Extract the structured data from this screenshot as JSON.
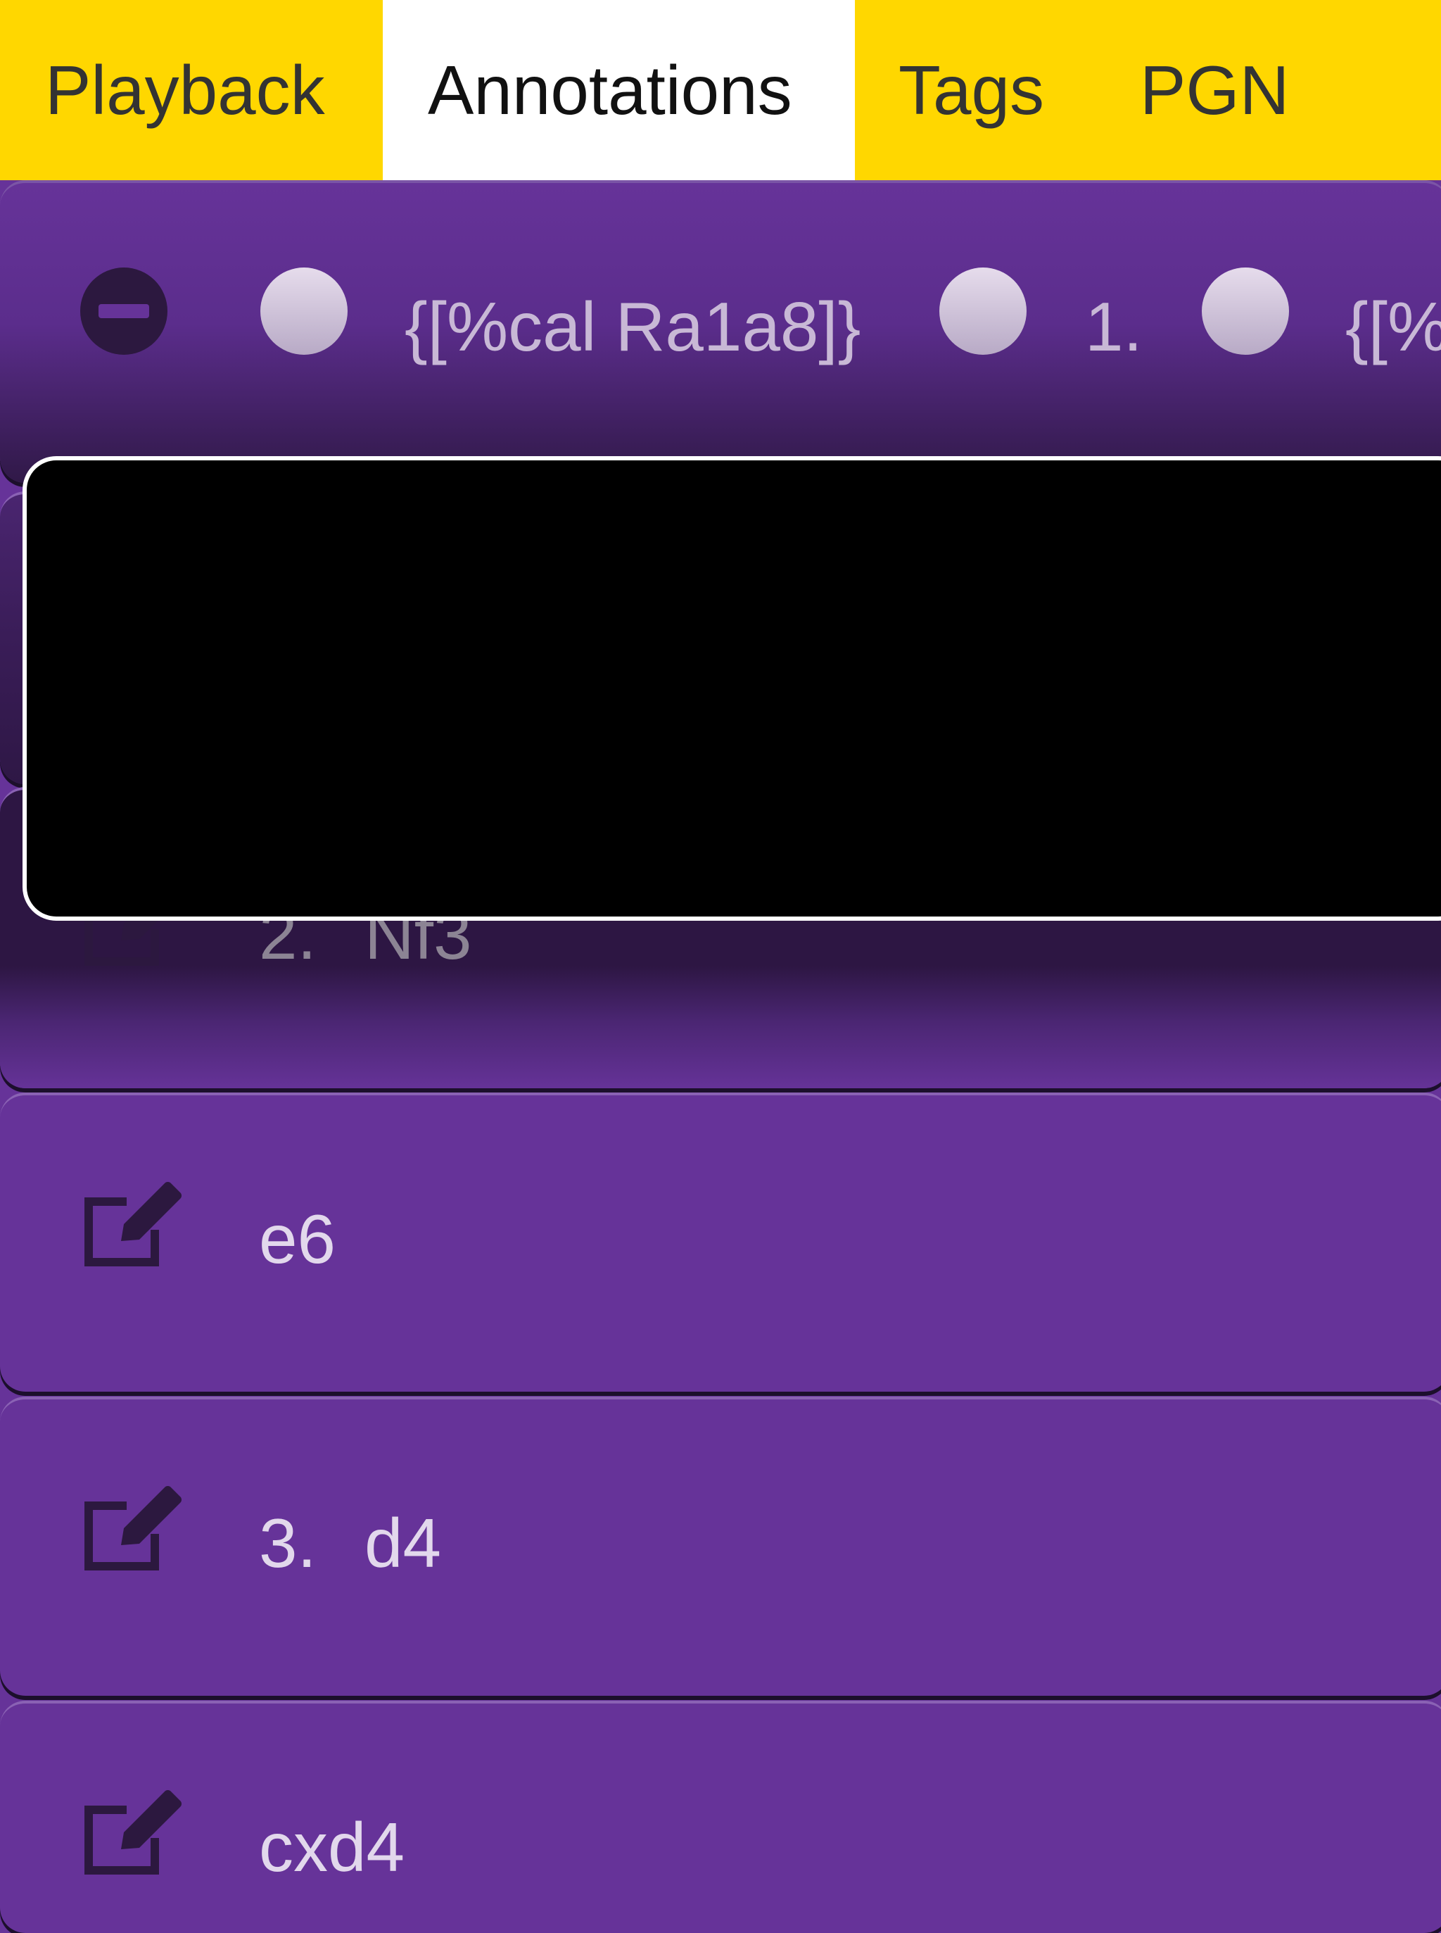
{
  "tabs": {
    "playback": "Playback",
    "annotations": "Annotations",
    "tags": "Tags",
    "pgn": "PGN"
  },
  "rows": {
    "first": {
      "comment1": "{[%cal Ra1a8]}",
      "move_number": "1.",
      "comment2_partial": "{[%"
    },
    "row3": {
      "number": "2.",
      "move": "Nf3"
    },
    "row4": {
      "move": "e6"
    },
    "row5": {
      "number": "3.",
      "move": "d4"
    },
    "row6": {
      "move": "cxd4"
    }
  },
  "colors": {
    "tab_bar": "#FFD700",
    "active_tab": "#FFFFFF",
    "row_background": "#663399",
    "modal_background": "#000000"
  }
}
